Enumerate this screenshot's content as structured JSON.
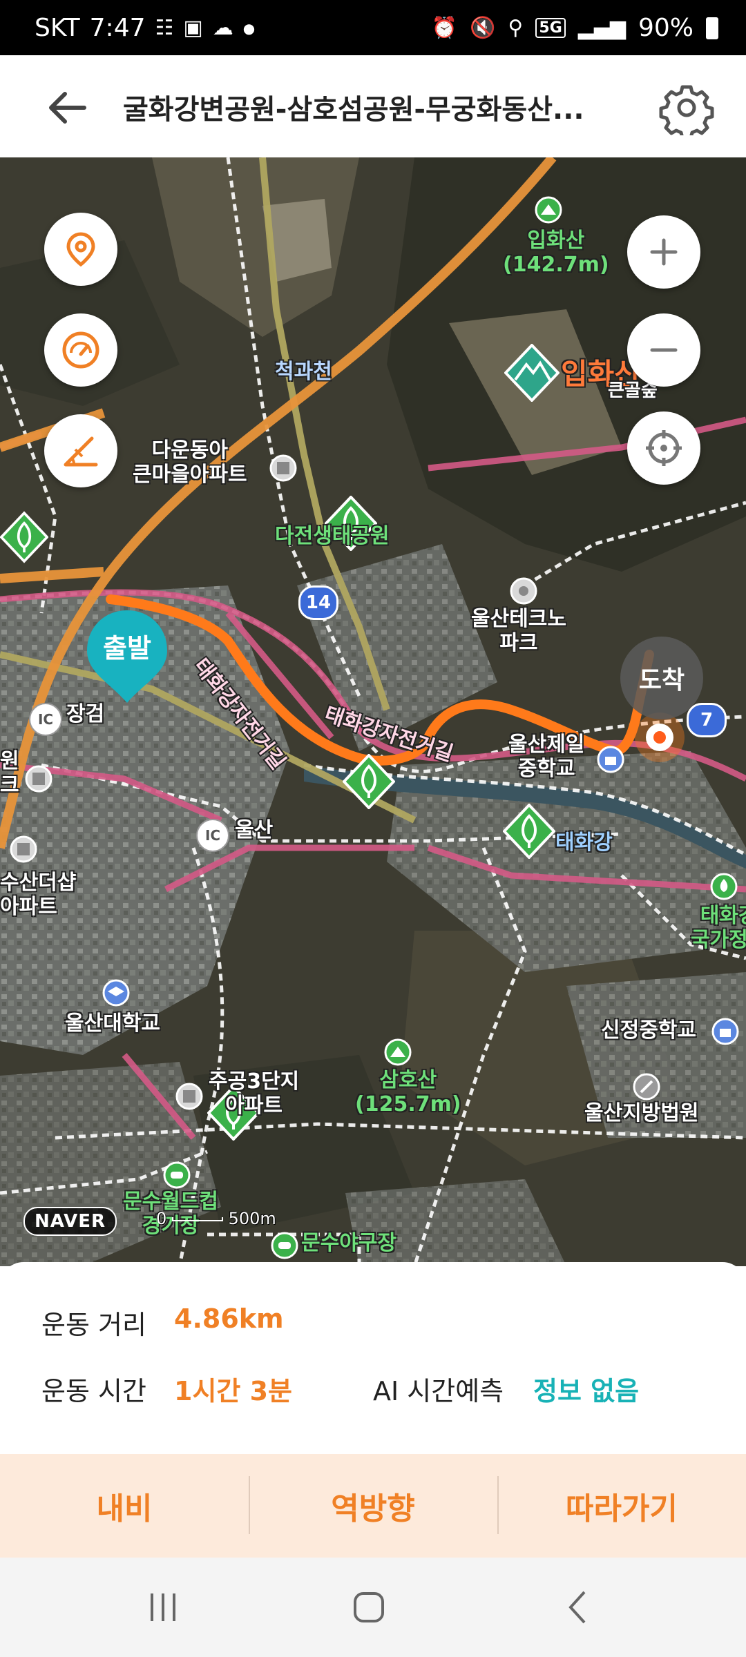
{
  "status_bar": {
    "carrier": "SKT",
    "time": "7:47",
    "network": "5G",
    "battery": "90%"
  },
  "header": {
    "title": "굴화강변공원-삼호섬공원-무궁화동산..."
  },
  "map": {
    "labels": {
      "iphwasan_peak": "입화산\n(142.7m)",
      "iphwasan_poi": "입화산",
      "iphwasan_poi_sub": "큰골숲",
      "cheokgwacheon": "척과천",
      "daun_apt": "다운동아\n큰마을아파트",
      "dajeon_park": "다전생태공원",
      "ulsan_techno": "울산테크노\n파크",
      "jangeom": "장검",
      "taehwa_bike1": "태화강자전거길",
      "taehwa_bike2": "태화강자전거길",
      "ulsan_jeil": "울산제일\n중학교",
      "taehwa_river": "태화강",
      "ulsan_ic": "울산",
      "suan_apt": "수산더샵\n아파트",
      "left_edge": "원\n크",
      "taehwa_national": "태화강\n국가정원",
      "ulsan_univ": "울산대학교",
      "sinjeong_ms": "신정중학교",
      "samhosan": "삼호산\n(125.7m)",
      "ulsan_court": "울산지방법원",
      "jugong3": "주공3단지\n아파트",
      "munsu_stadium": "문수월드컵\n경기장",
      "munsu_baseball": "문수야구장"
    },
    "road_badges": {
      "route14": "14",
      "route7": "7",
      "ic": "IC"
    },
    "start_label": "출발",
    "end_label": "도착",
    "naver": "NAVER",
    "scale_zero": "0",
    "scale_distance": "500m"
  },
  "stats": {
    "distance_label": "운동 거리",
    "distance_value": "4.86km",
    "time_label": "운동 시간",
    "time_value": "1시간 3분",
    "ai_label": "AI 시간예측",
    "ai_value": "정보 없음"
  },
  "actions": {
    "navi": "내비",
    "reverse": "역방향",
    "follow": "따라가기"
  },
  "colors": {
    "accent": "#f08025",
    "teal": "#18b2b6",
    "route": "#ff7a1a",
    "start_marker": "#18b2c0"
  }
}
